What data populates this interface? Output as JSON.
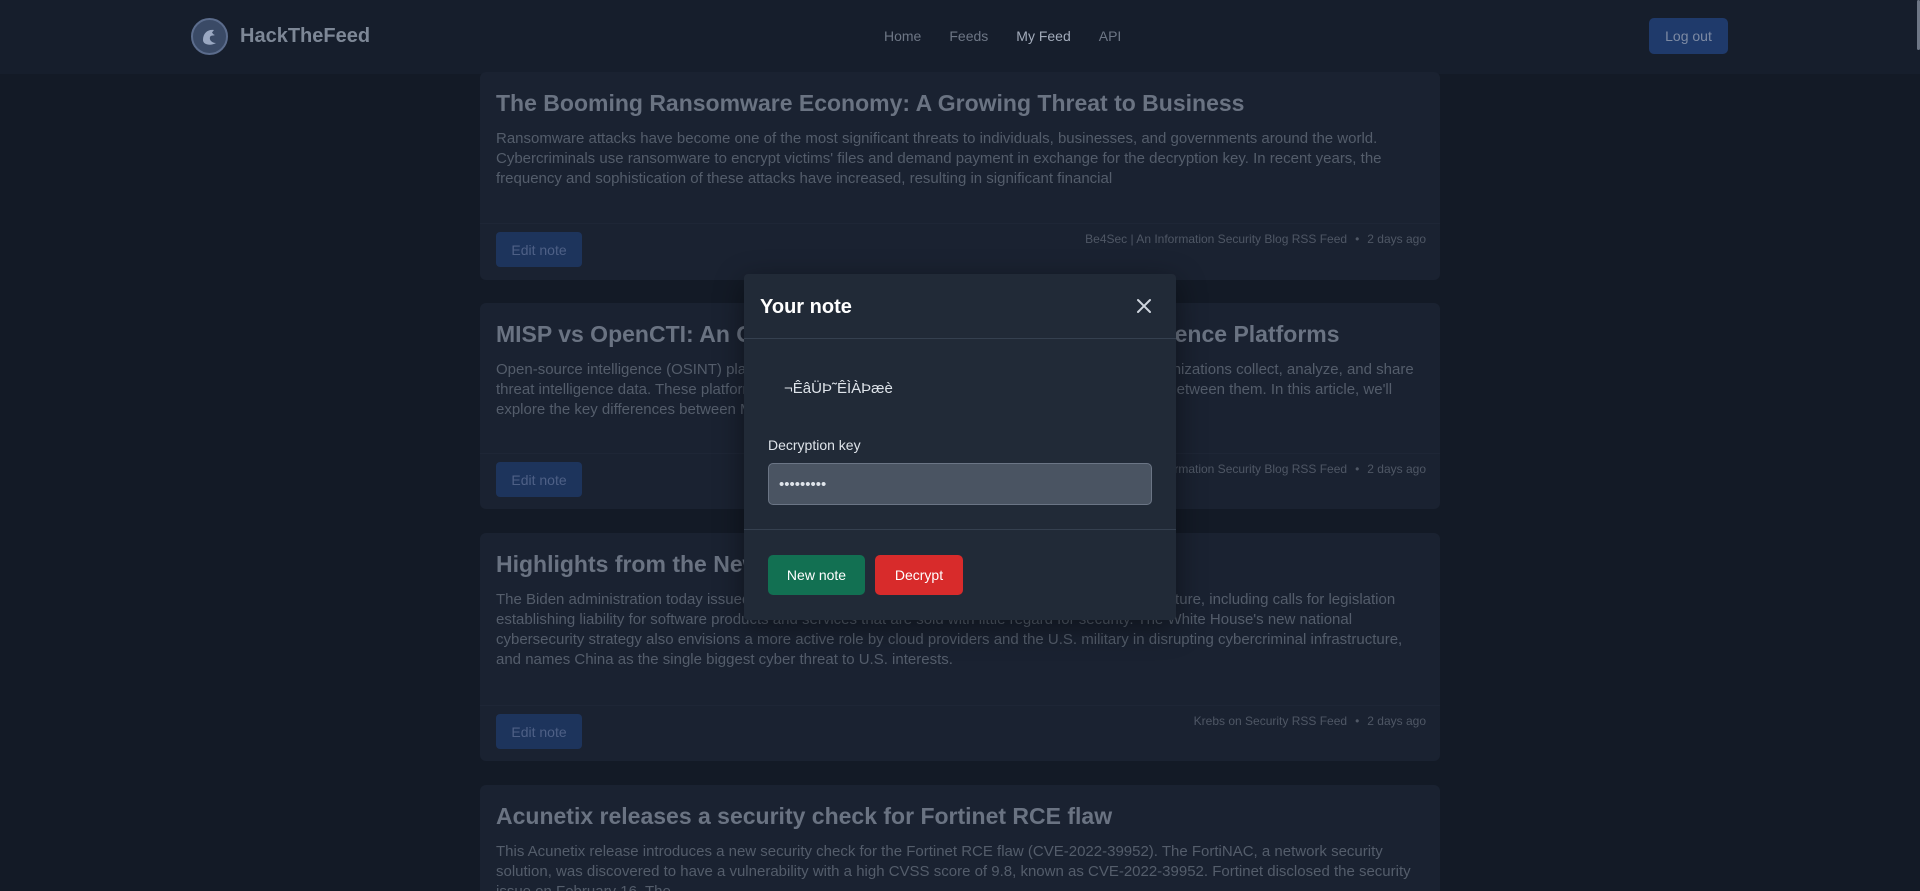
{
  "nav": {
    "brand": "HackTheFeed",
    "links": [
      "Home",
      "Feeds",
      "My Feed",
      "API"
    ],
    "active_link": "My Feed",
    "logout_label": "Log out"
  },
  "cards": [
    {
      "title": "The Booming Ransomware Economy: A Growing Threat to Business",
      "body": "Ransomware attacks have become one of the most significant threats to individuals, businesses, and governments around the world. Cybercriminals use ransomware to encrypt victims' files and demand payment in exchange for the decryption key. In recent years, the frequency and sophistication of these attacks have increased, resulting in significant financial",
      "edit_label": "Edit note",
      "source": "Be4Sec | An Information Security Blog RSS Feed",
      "time": "2 days ago"
    },
    {
      "title": "MISP vs OpenCTI: An Overview of Open-Source Threat Intelligence Platforms",
      "body": "Open-source intelligence (OSINT) platforms like MISP and OpenCTI have revolutionized the way organizations collect, analyze, and share threat intelligence data. These platforms share similar objectives, but there are significant differences between them. In this article, we'll explore the key differences between MISP and OpenCTI",
      "edit_label": "Edit note",
      "source": "Be4Sec | An Information Security Blog RSS Feed",
      "time": "2 days ago"
    },
    {
      "title": "Highlights from the New U.S. Cybersecurity Strategy",
      "body": "The Biden administration today issued its vision for beefing up the nation's collective cybersecurity posture, including calls for legislation establishing liability for software products and services that are sold with little regard for security. The White House's new national cybersecurity strategy also envisions a more active role by cloud providers and the U.S. military in disrupting cybercriminal infrastructure, and names China as the single biggest cyber threat to U.S. interests.",
      "edit_label": "Edit note",
      "source": "Krebs on Security RSS Feed",
      "time": "2 days ago"
    },
    {
      "title": "Acunetix releases a security check for Fortinet RCE flaw",
      "body": "This Acunetix release introduces a new security check for the Fortinet RCE flaw (CVE-2022-39952). The FortiNAC, a network security solution, was discovered to have a vulnerability with a high CVSS score of 9.8, known as CVE-2022-39952. Fortinet disclosed the security issue on February 16. The",
      "edit_label": "Edit note",
      "source": "",
      "time": ""
    }
  ],
  "modal": {
    "title": "Your note",
    "note_text": "¬ÊâÜÞ˜ÊÌÀÞæè",
    "key_label": "Decryption key",
    "key_value": "secretkey",
    "new_note_label": "New note",
    "decrypt_label": "Decrypt"
  },
  "colors": {
    "background": "#131a26",
    "navbar": "#161e2c",
    "card": "#1a2231",
    "modal": "#212a37",
    "primary_blue": "#1d345c",
    "success_green": "#127052",
    "danger_red": "#d82b2b"
  }
}
